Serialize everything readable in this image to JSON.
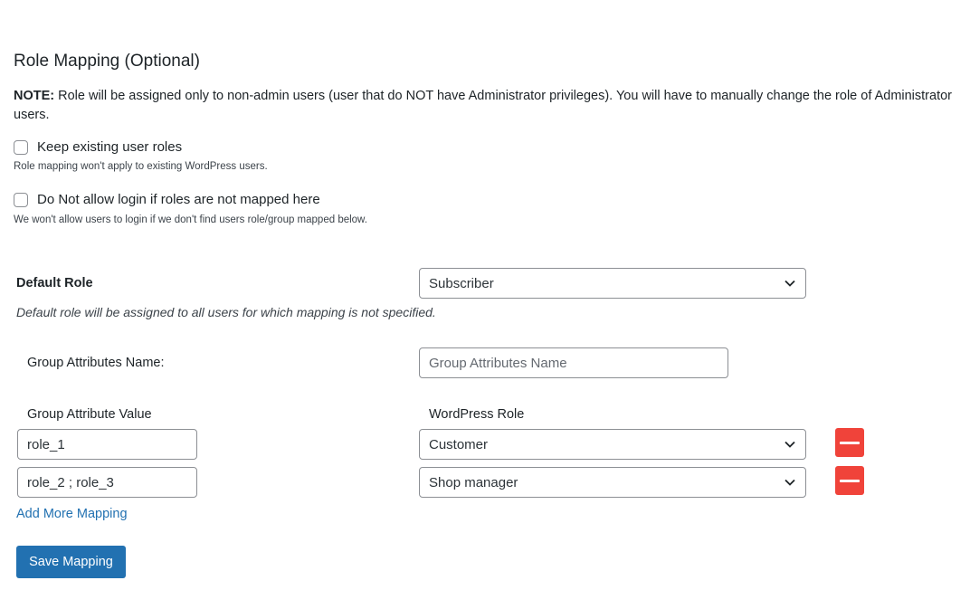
{
  "section": {
    "title": "Role Mapping (Optional)",
    "note_prefix": "NOTE:",
    "note_text": " Role will be assigned only to non-admin users (user that do NOT have Administrator privileges). You will have to manually change the role of Administrator users."
  },
  "options": [
    {
      "label": "Keep existing user roles",
      "hint": "Role mapping won't apply to existing WordPress users.",
      "checked": false
    },
    {
      "label": "Do Not allow login if roles are not mapped here",
      "hint": "We won't allow users to login if we don't find users role/group mapped below.",
      "checked": false
    }
  ],
  "default_role": {
    "label": "Default Role",
    "value": "Subscriber",
    "description": "Default role will be assigned to all users for which mapping is not specified."
  },
  "group_attributes": {
    "label": "Group Attributes Name:",
    "placeholder": "Group Attributes Name",
    "value": ""
  },
  "mapping": {
    "col_value_header": "Group Attribute Value",
    "col_role_header": "WordPress Role",
    "rows": [
      {
        "value": "role_1",
        "role": "Customer"
      },
      {
        "value": "role_2 ; role_3",
        "role": "Shop manager"
      }
    ],
    "add_more_label": "Add More Mapping",
    "save_label": "Save Mapping"
  },
  "colors": {
    "accent": "#2271b1",
    "remove": "#f0433a",
    "border": "#8c8f94"
  }
}
